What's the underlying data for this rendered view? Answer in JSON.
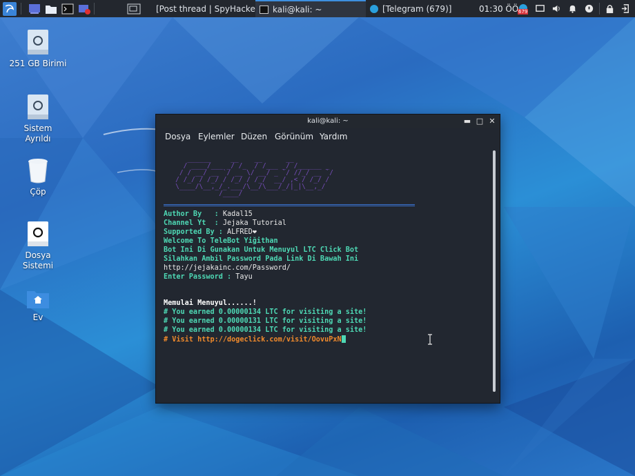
{
  "panel": {
    "tasks": [
      {
        "label": "[Post thread | SpyHacke...",
        "icon": "firefox-icon"
      },
      {
        "label": "kali@kali: ~",
        "icon": "terminal-icon"
      },
      {
        "label": "[Telegram (679)]",
        "icon": "telegram-icon"
      }
    ],
    "clock": "01:30 ÖÖ",
    "badge": "679"
  },
  "desktop": {
    "icons": [
      {
        "label": "251 GB Birimi"
      },
      {
        "label": "Sistem Ayrıldı"
      },
      {
        "label": "Çöp"
      },
      {
        "label": "Dosya Sistemi"
      },
      {
        "label": "Ev"
      }
    ]
  },
  "terminal": {
    "title": "kali@kali: ~",
    "menu": [
      "Dosya",
      "Eylemler",
      "Düzen",
      "Görünüm",
      "Yardım"
    ],
    "lines": {
      "author_label": "Author By   : ",
      "author_value": "Kadal15",
      "channel_label": "Channel Yt  : ",
      "channel_value": "Jejaka Tutorial",
      "supported_label": "Supported By : ",
      "supported_value": "ALFRED❤",
      "welcome": "Welcome To TeleBot Yiğithan",
      "bot_desc": "Bot Ini Di Gunakan Untuk Menuyul LTC Click Bot",
      "password_hint": "Silahkan Ambil Password Pada Link Di Bawah Ini",
      "password_url": "http://jejakainc.com/Password/",
      "enter_label": "Enter Password : ",
      "enter_value": "Tayu",
      "start": "Memulai Menuyul......!",
      "earned_1": "# You earned 0.00000134 LTC for visiting a site!",
      "earned_2": "# You earned 0.00000131 LTC for visiting a site!",
      "earned_3": "# You earned 0.00000134 LTC for visiting a site!",
      "visit": "# Visit http://dogeclick.com/visit/OovuPxN"
    }
  },
  "colors": {
    "panel_bg": "#23272e",
    "terminal_bg": "#222730",
    "accent_green": "#4ed8b4",
    "accent_orange": "#f08a2c"
  }
}
